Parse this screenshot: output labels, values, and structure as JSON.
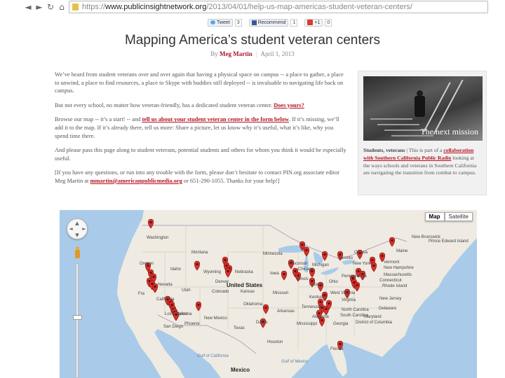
{
  "browser": {
    "url_scheme": "https://",
    "url_domain": "www.publicinsightnetwork.org",
    "url_path": "/2013/04/01/help-us-map-americas-student-veteran-centers/"
  },
  "share": {
    "tweet_label": "Tweet",
    "tweet_count": "3",
    "recommend_label": "Recommend",
    "recommend_count": "1",
    "gplus_label": "+1",
    "gplus_count": "0"
  },
  "article": {
    "title": "Mapping America’s student veteran centers",
    "by": "By",
    "author": "Meg Martin",
    "separator": "|",
    "date": "April 1, 2013",
    "p1": "We’ve heard from student veterans over and over again that having a physical space on campus -- a place to gather, a place to unwind, a place to find resources, a place to Skype with buddies still deployed -- is invaluable to navigating life back on campus.",
    "p2_text": "But not every school, no matter how veteran-friendly, has a dedicated student veteran center.",
    "p2_link": "Does yours?",
    "p3_pre": "Browse our map -- it’s a start! -- and",
    "p3_link": "tell us about your student veteran center in the form below",
    "p3_post": ". If it’s missing, we’ll add it to the map. If it’s already there, tell us more: Share a picture, let us know why it’s useful, what it’s like, why you spend time there.",
    "p4": "And please pass this page along to student veterans, potential students and others for whom you think it would be especially useful.",
    "p5_pre": "[If you have any questions, or run into any trouble with the form, please don’t hesitate to contact PIN.org associate editor Meg Martin at",
    "p5_link": "mmartin@americanpublicmedia.org",
    "p5_post": "or 651-290-1055. Thanks for your help!]"
  },
  "sidebar": {
    "caption": "The next mission",
    "lead": "Students, veterans",
    "sep": "|",
    "text_pre": "This is part of a",
    "link": "collaboration with Southern California Public Radio",
    "text_post": "looking at the ways schools and veterans in Southern California are navigating the transition from combat to campus."
  },
  "map": {
    "map_label": "Map",
    "satellite_label": "Satellite",
    "labels": {
      "washington": "Washington",
      "montana": "Montana",
      "idaho": "Idaho",
      "oregon": "Oregon",
      "nevada": "Nevada",
      "california": "California",
      "utah": "Utah",
      "wyoming": "Wyoming",
      "colorado": "Colorado",
      "arizona": "Arizona",
      "new_mexico": "New Mexico",
      "united_states": "United States",
      "nebraska": "Nebraska",
      "kansas": "Kansas",
      "oklahoma": "Oklahoma",
      "texas": "Texas",
      "missouri": "Missouri",
      "arkansas": "Arkansas",
      "mississippi": "Mississippi",
      "georgia": "Georgia",
      "alabama": "Alabama",
      "tennessee": "Tennessee",
      "kentucky": "Kentucky",
      "illinois": "Illinois",
      "indiana": "Indiana",
      "ohio": "Ohio",
      "michigan": "Michigan",
      "wisconsin": "Wisconsin",
      "iowa": "Iowa",
      "minnesota": "Minnesota",
      "west_virginia": "West Virginia",
      "virginia": "Virginia",
      "north_carolina": "North Carolina",
      "south_carolina": "South Carolina",
      "florida": "Florida",
      "pennsylvania": "Pennsylvania",
      "new_york": "New York",
      "new_jersey": "New Jersey",
      "delaware": "Delaware",
      "maryland": "Maryland",
      "district_of_columbia": "District of Columbia",
      "connecticut": "Connecticut",
      "rhode_island": "Rhode Island",
      "massachusetts": "Massachusetts",
      "vermont": "Vermont",
      "new_hampshire": "New Hampshire",
      "maine": "Maine",
      "new_brunswick": "New Brunswick",
      "prince_edward_island": "Prince Edward Island",
      "ottawa": "Ottawa",
      "toronto": "Toronto",
      "chicago": "Chicago",
      "denver": "Denver",
      "dallas": "Dallas",
      "houston": "Houston",
      "phoenix": "Phoenix",
      "san_diego": "San Diego",
      "los_angeles": "Los Angeles",
      "san_francisco": "Fra",
      "mexico": "Mexico",
      "gulf_of_california": "Gulf of California",
      "gulf_of_mexico": "Gulf of Mexico"
    },
    "marker_color": "#d9302c",
    "land_color": "#efebe2",
    "water_color": "#a9cbe9"
  }
}
